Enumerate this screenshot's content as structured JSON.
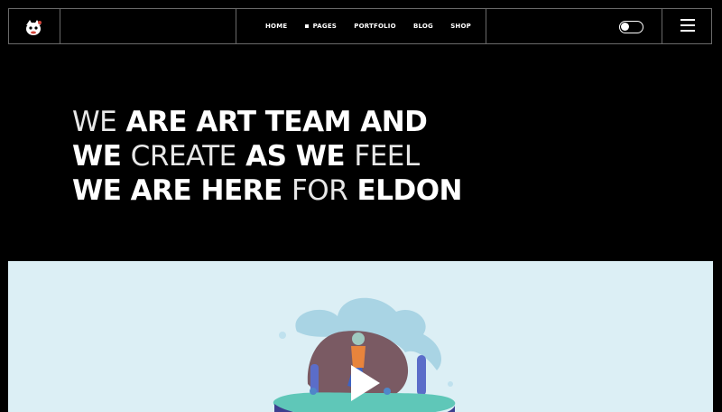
{
  "header": {
    "nav": [
      {
        "label": "HOME",
        "active": false
      },
      {
        "label": "PAGES",
        "active": true
      },
      {
        "label": "PORTFOLIO",
        "active": false
      },
      {
        "label": "BLOG",
        "active": false
      },
      {
        "label": "SHOP",
        "active": false
      }
    ]
  },
  "hero": {
    "line1": {
      "w1": "WE",
      "w2": "ARE ART TEAM AND"
    },
    "line2": {
      "w1": "WE",
      "w2": "CREATE",
      "w3": "AS WE",
      "w4": "FEEL"
    },
    "line3": {
      "w1": "WE ARE HERE",
      "w2": "FOR",
      "w3": "ELDON"
    }
  },
  "colors": {
    "background": "#000000",
    "border": "#6a6a6a",
    "media_bg": "#dceff5"
  },
  "icons": [
    "logo-icon",
    "theme-toggle-icon",
    "hamburger-menu-icon",
    "play-icon"
  ]
}
